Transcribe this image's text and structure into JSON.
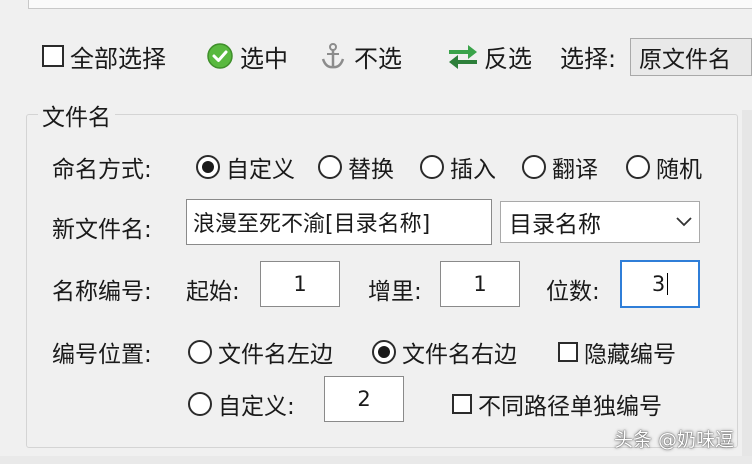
{
  "toolbar": {
    "select_all_label": "全部选择",
    "select_label": "选中",
    "deselect_label": "不选",
    "invert_label": "反选",
    "choose_label": "选择:",
    "choose_value": "原文件名"
  },
  "group": {
    "title": "文件名",
    "naming_method": {
      "label": "命名方式:",
      "options": [
        "自定义",
        "替换",
        "插入",
        "翻译",
        "随机"
      ],
      "selected": "自定义"
    },
    "new_name": {
      "label": "新文件名:",
      "value": "浪漫至死不渝[目录名称]",
      "dropdown_value": "目录名称"
    },
    "numbering": {
      "label": "名称编号:",
      "start_label": "起始:",
      "start_value": "1",
      "step_label": "增里:",
      "step_value": "1",
      "digits_label": "位数:",
      "digits_value": "3"
    },
    "position": {
      "label": "编号位置:",
      "left_label": "文件名左边",
      "right_label": "文件名右边",
      "selected": "文件名右边",
      "hide_label": "隐藏编号",
      "custom_label": "自定义:",
      "custom_value": "2",
      "separate_label": "不同路径单独编号"
    }
  },
  "watermark": "头条 @奶味逗"
}
